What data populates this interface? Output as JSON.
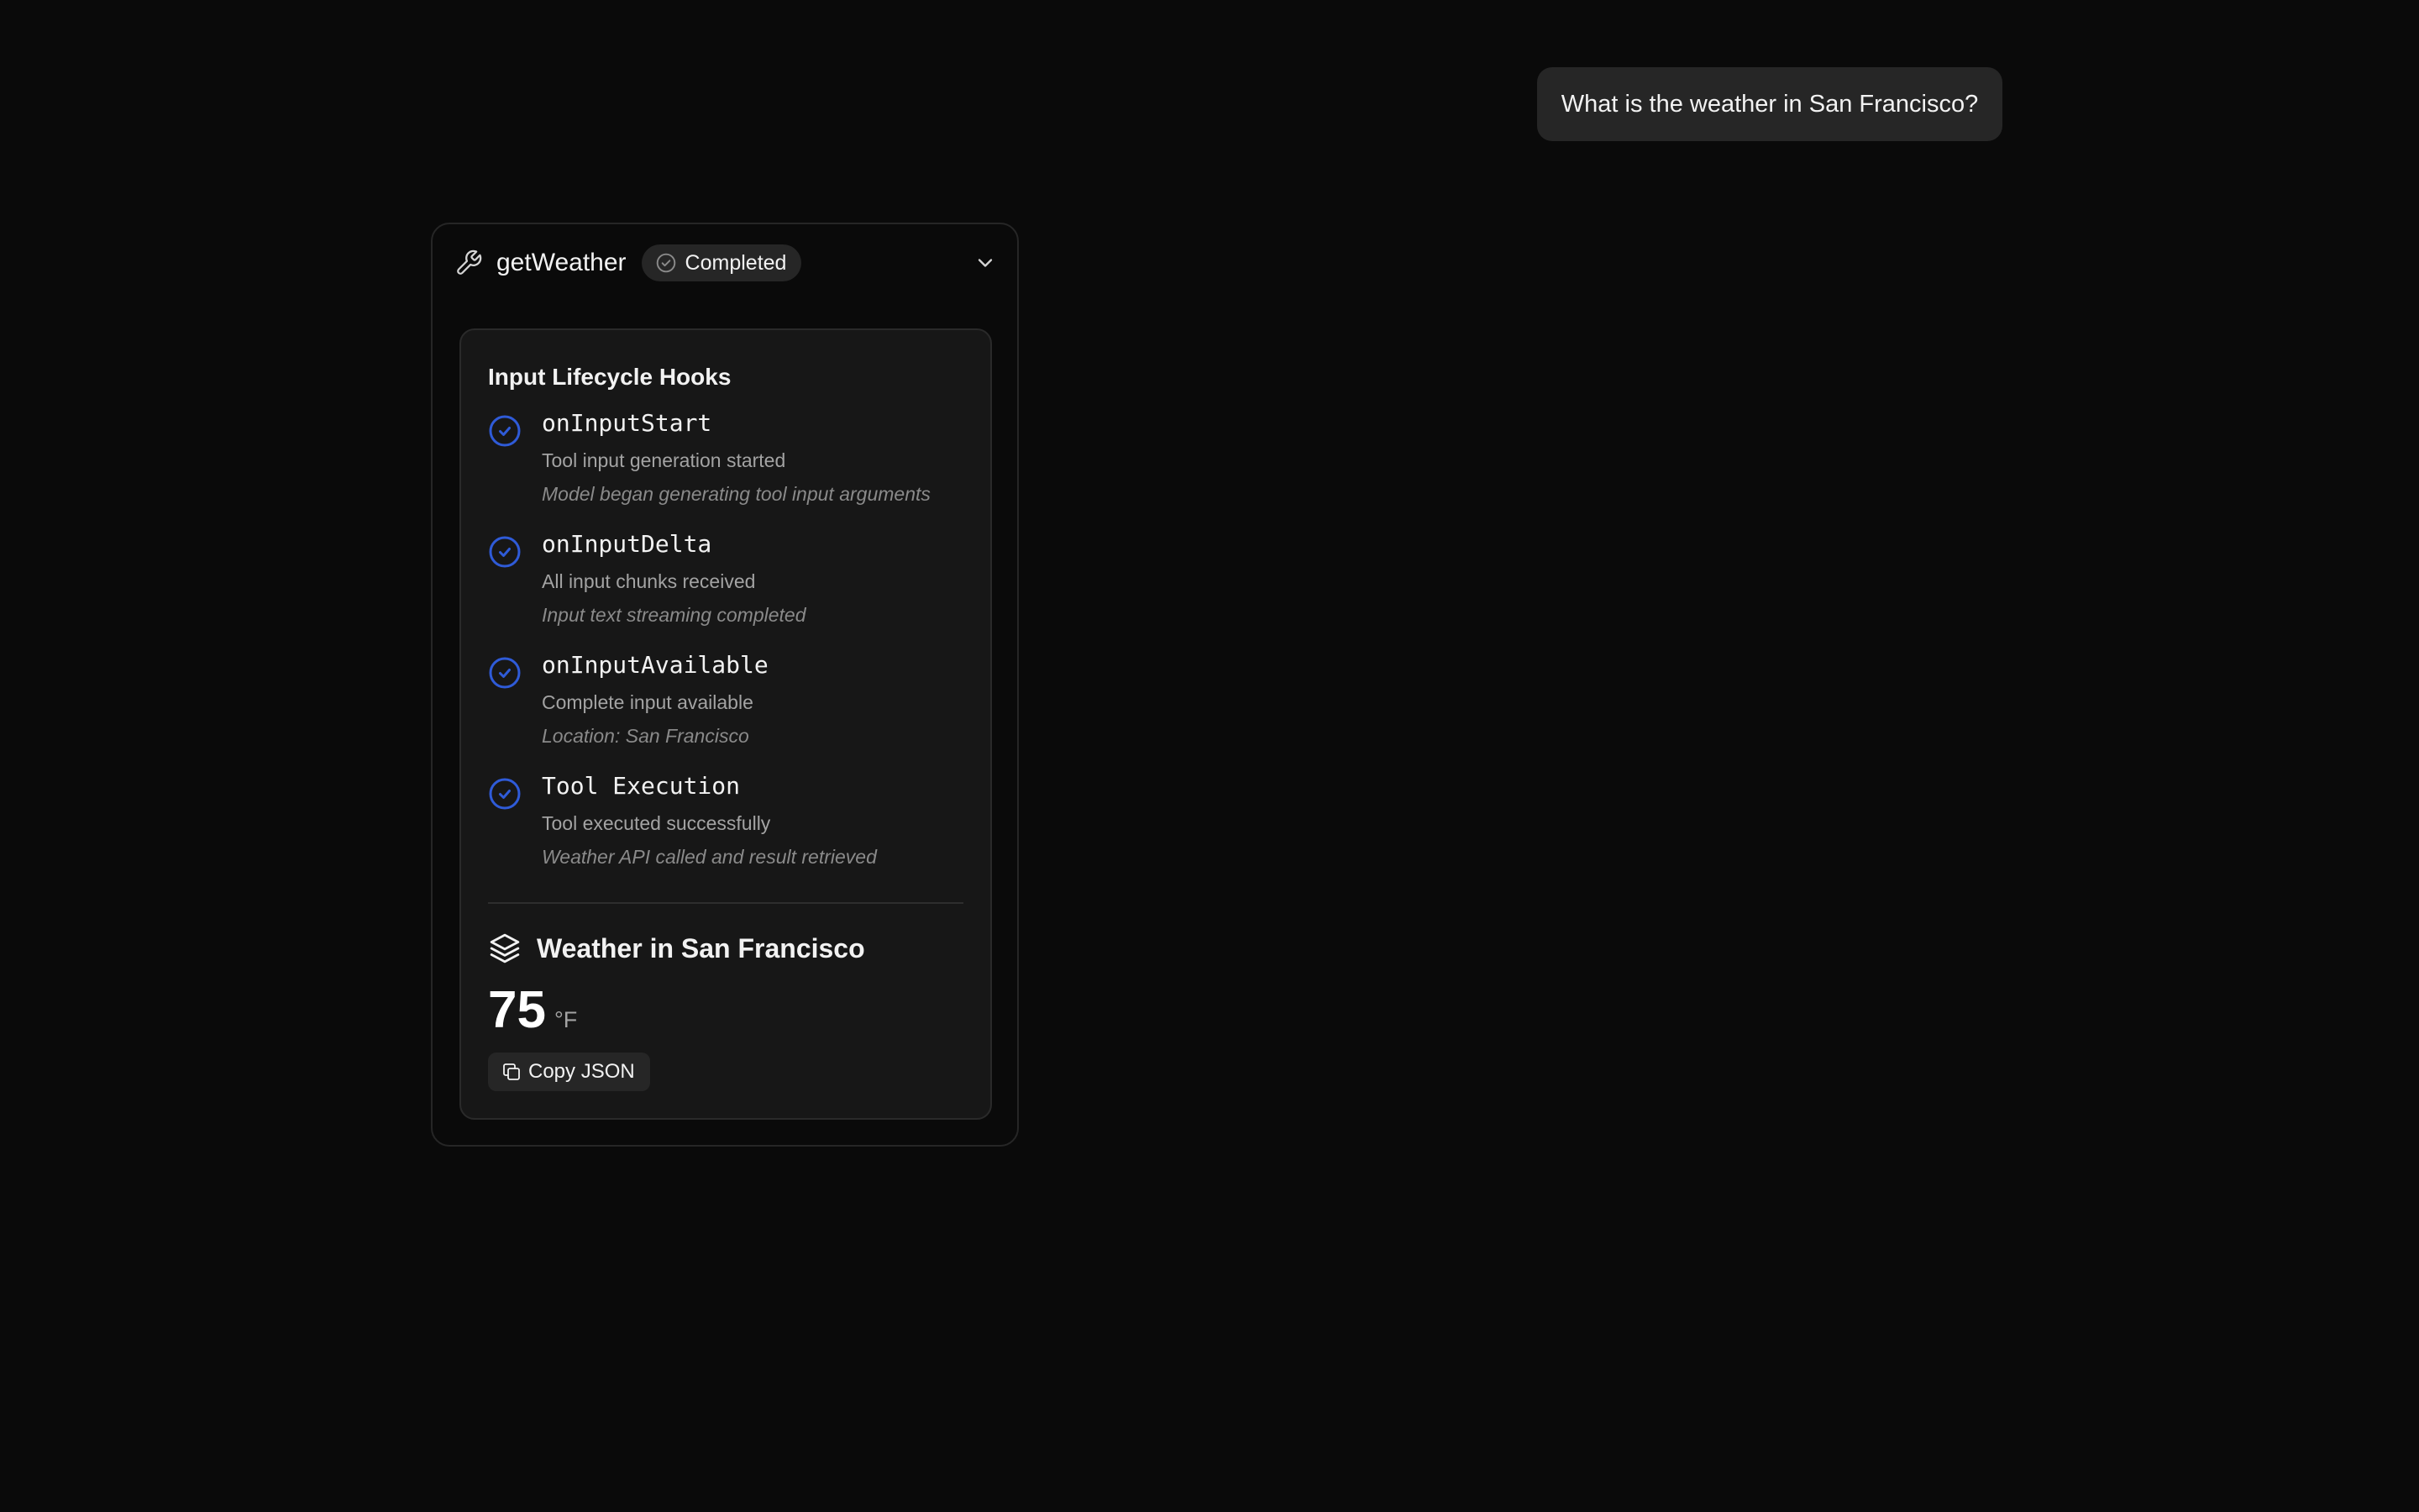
{
  "user_message": {
    "text": "What is the weather in San Francisco?"
  },
  "tool": {
    "name": "getWeather",
    "status": "Completed",
    "icon": "wrench-icon",
    "status_icon": "check-circle-icon",
    "collapse_icon": "chevron-down-icon"
  },
  "hooks": {
    "title": "Input Lifecycle Hooks",
    "items": [
      {
        "name": "onInputStart",
        "description": "Tool input generation started",
        "detail": "Model began generating tool input arguments",
        "icon": "check-circle-icon"
      },
      {
        "name": "onInputDelta",
        "description": "All input chunks received",
        "detail": "Input text streaming completed",
        "icon": "check-circle-icon"
      },
      {
        "name": "onInputAvailable",
        "description": "Complete input available",
        "detail": "Location: San Francisco",
        "icon": "check-circle-icon"
      },
      {
        "name": "Tool Execution",
        "description": "Tool executed successfully",
        "detail": "Weather API called and result retrieved",
        "icon": "check-circle-icon"
      }
    ]
  },
  "result": {
    "icon": "layers-icon",
    "title": "Weather in San Francisco",
    "temperature": "75",
    "unit": "°F",
    "copy_label": "Copy JSON",
    "copy_icon": "copy-icon"
  },
  "colors": {
    "background": "#0a0a0a",
    "panel": "#171717",
    "badge": "#262626",
    "accent_blue": "#2f5bd8"
  }
}
